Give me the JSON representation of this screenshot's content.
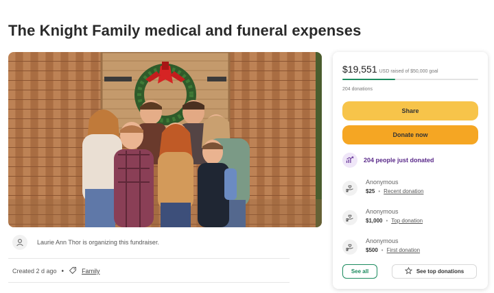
{
  "page": {
    "title": "The Knight Family medical and funeral expenses"
  },
  "organizer": {
    "text": "Laurie Ann Thor is organizing this fundraiser.",
    "icon": "person-icon"
  },
  "meta": {
    "created": "Created 2 d ago",
    "separator": "•",
    "category": "Family",
    "icon": "tag-icon"
  },
  "card": {
    "raised_amount": "$19,551",
    "raised_sub": "USD raised of $50,000 goal",
    "progress_fraction": 0.391,
    "donations_count": "204 donations",
    "share_label": "Share",
    "donate_label": "Donate now",
    "just_donated": "204 people just donated",
    "donors": [
      {
        "name": "Anonymous",
        "amount": "$25",
        "label": "Recent donation"
      },
      {
        "name": "Anonymous",
        "amount": "$1,000",
        "label": "Top donation"
      },
      {
        "name": "Anonymous",
        "amount": "$500",
        "label": "First donation"
      }
    ],
    "see_all_label": "See all",
    "see_top_label": "See top donations"
  },
  "colors": {
    "accent_green": "#1a8a5d",
    "share_yellow": "#f7c44a",
    "donate_orange": "#f5a623",
    "purple": "#5a2a8a"
  }
}
